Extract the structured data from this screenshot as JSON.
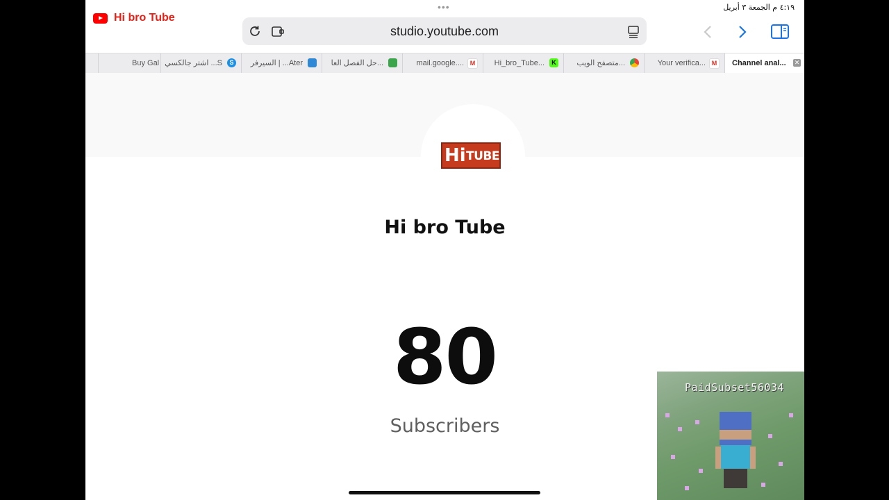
{
  "status_bar": {
    "time_date": "٤:١٩ م   الجمعة ٣ أبريل"
  },
  "browser": {
    "url": "studio.youtube.com",
    "tabs": [
      {
        "label": "Buy Gal",
        "favicon": ""
      },
      {
        "label": "اشتر جالكسي ...S",
        "favicon": "S"
      },
      {
        "label": "السيرفر | ...Ater",
        "favicon": "A"
      },
      {
        "label": "حل الفصل العا...",
        "favicon": "briefcase"
      },
      {
        "label": "mail.google....",
        "favicon": "M"
      },
      {
        "label": "Hi_bro_Tube...",
        "favicon": "K"
      },
      {
        "label": "متصفح الويب...",
        "favicon": "chrome"
      },
      {
        "label": "Your verifica...",
        "favicon": "M"
      },
      {
        "label": "Channel anal...",
        "favicon": "",
        "active": true
      }
    ],
    "colors": {
      "gmail": "#d93025",
      "kick": "#53fc18",
      "skype": "#1a91e6",
      "green": "#3aa54a"
    }
  },
  "brand_overlay": {
    "name": "Hi bro Tube"
  },
  "channel": {
    "logo_left": "Hi",
    "logo_right": "TUBE",
    "name": "Hi bro Tube",
    "subscriber_count": "80",
    "subscriber_label": "Subscribers"
  },
  "game_overlay": {
    "player_name": "PaidSubset56034"
  }
}
